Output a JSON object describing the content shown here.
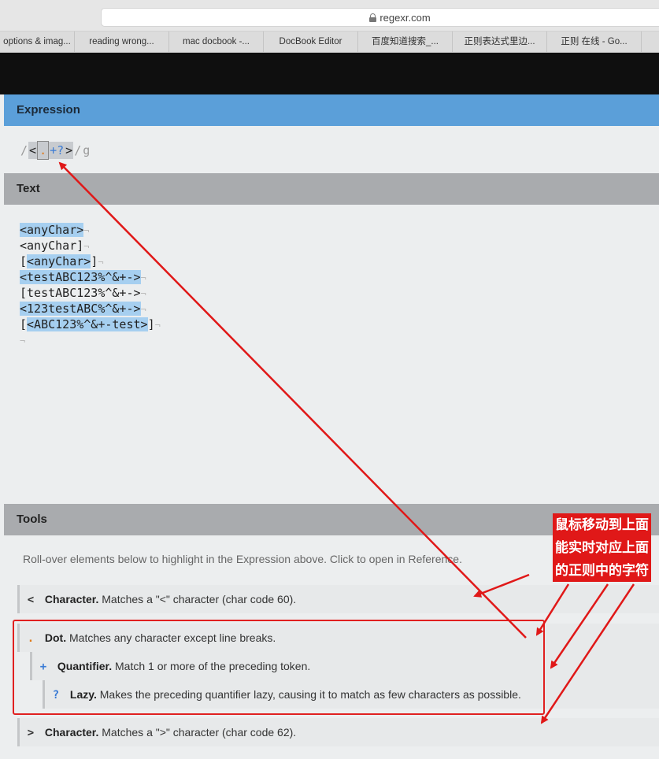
{
  "browser": {
    "url": "regexr.com",
    "bookmarks": [
      "options & imag...",
      "reading wrong...",
      "mac docbook -...",
      "DocBook Editor",
      "百度知道搜索_...",
      "正则表达式里边...",
      "正则 在线 - Go..."
    ]
  },
  "expression": {
    "heading": "Expression",
    "open_delim": "/",
    "tokens": [
      "<",
      ".",
      "+?",
      ">"
    ],
    "close_delim": "/",
    "flags": "g"
  },
  "text": {
    "heading": "Text",
    "lines": [
      "<anyChar>",
      "<anyChar]",
      "[<anyChar>]",
      "<testABC123%^&+->",
      "[testABC123%^&+->",
      "<123testABC%^&+->",
      "[<ABC123%^&+-test>]"
    ],
    "pilcrow": "¬"
  },
  "tools": {
    "heading": "Tools",
    "description": "Roll-over elements below to highlight in the Expression above. Click to open in Reference.",
    "items": [
      {
        "symbol": "<",
        "title": "Character.",
        "desc": "Matches a \"<\" character (char code 60)."
      },
      {
        "symbol": ".",
        "title": "Dot.",
        "desc": "Matches any character except line breaks."
      },
      {
        "symbol": "+",
        "title": "Quantifier.",
        "desc": "Match 1 or more of the preceding token."
      },
      {
        "symbol": "?",
        "title": "Lazy.",
        "desc": "Makes the preceding quantifier lazy, causing it to match as few characters as possible."
      },
      {
        "symbol": ">",
        "title": "Character.",
        "desc": "Matches a \">\" character (char code 62)."
      }
    ]
  },
  "annotation": {
    "lines": [
      "鼠标移动到上面",
      "能实时对应上面",
      "的正则中的字符"
    ],
    "color": "#e01818"
  }
}
